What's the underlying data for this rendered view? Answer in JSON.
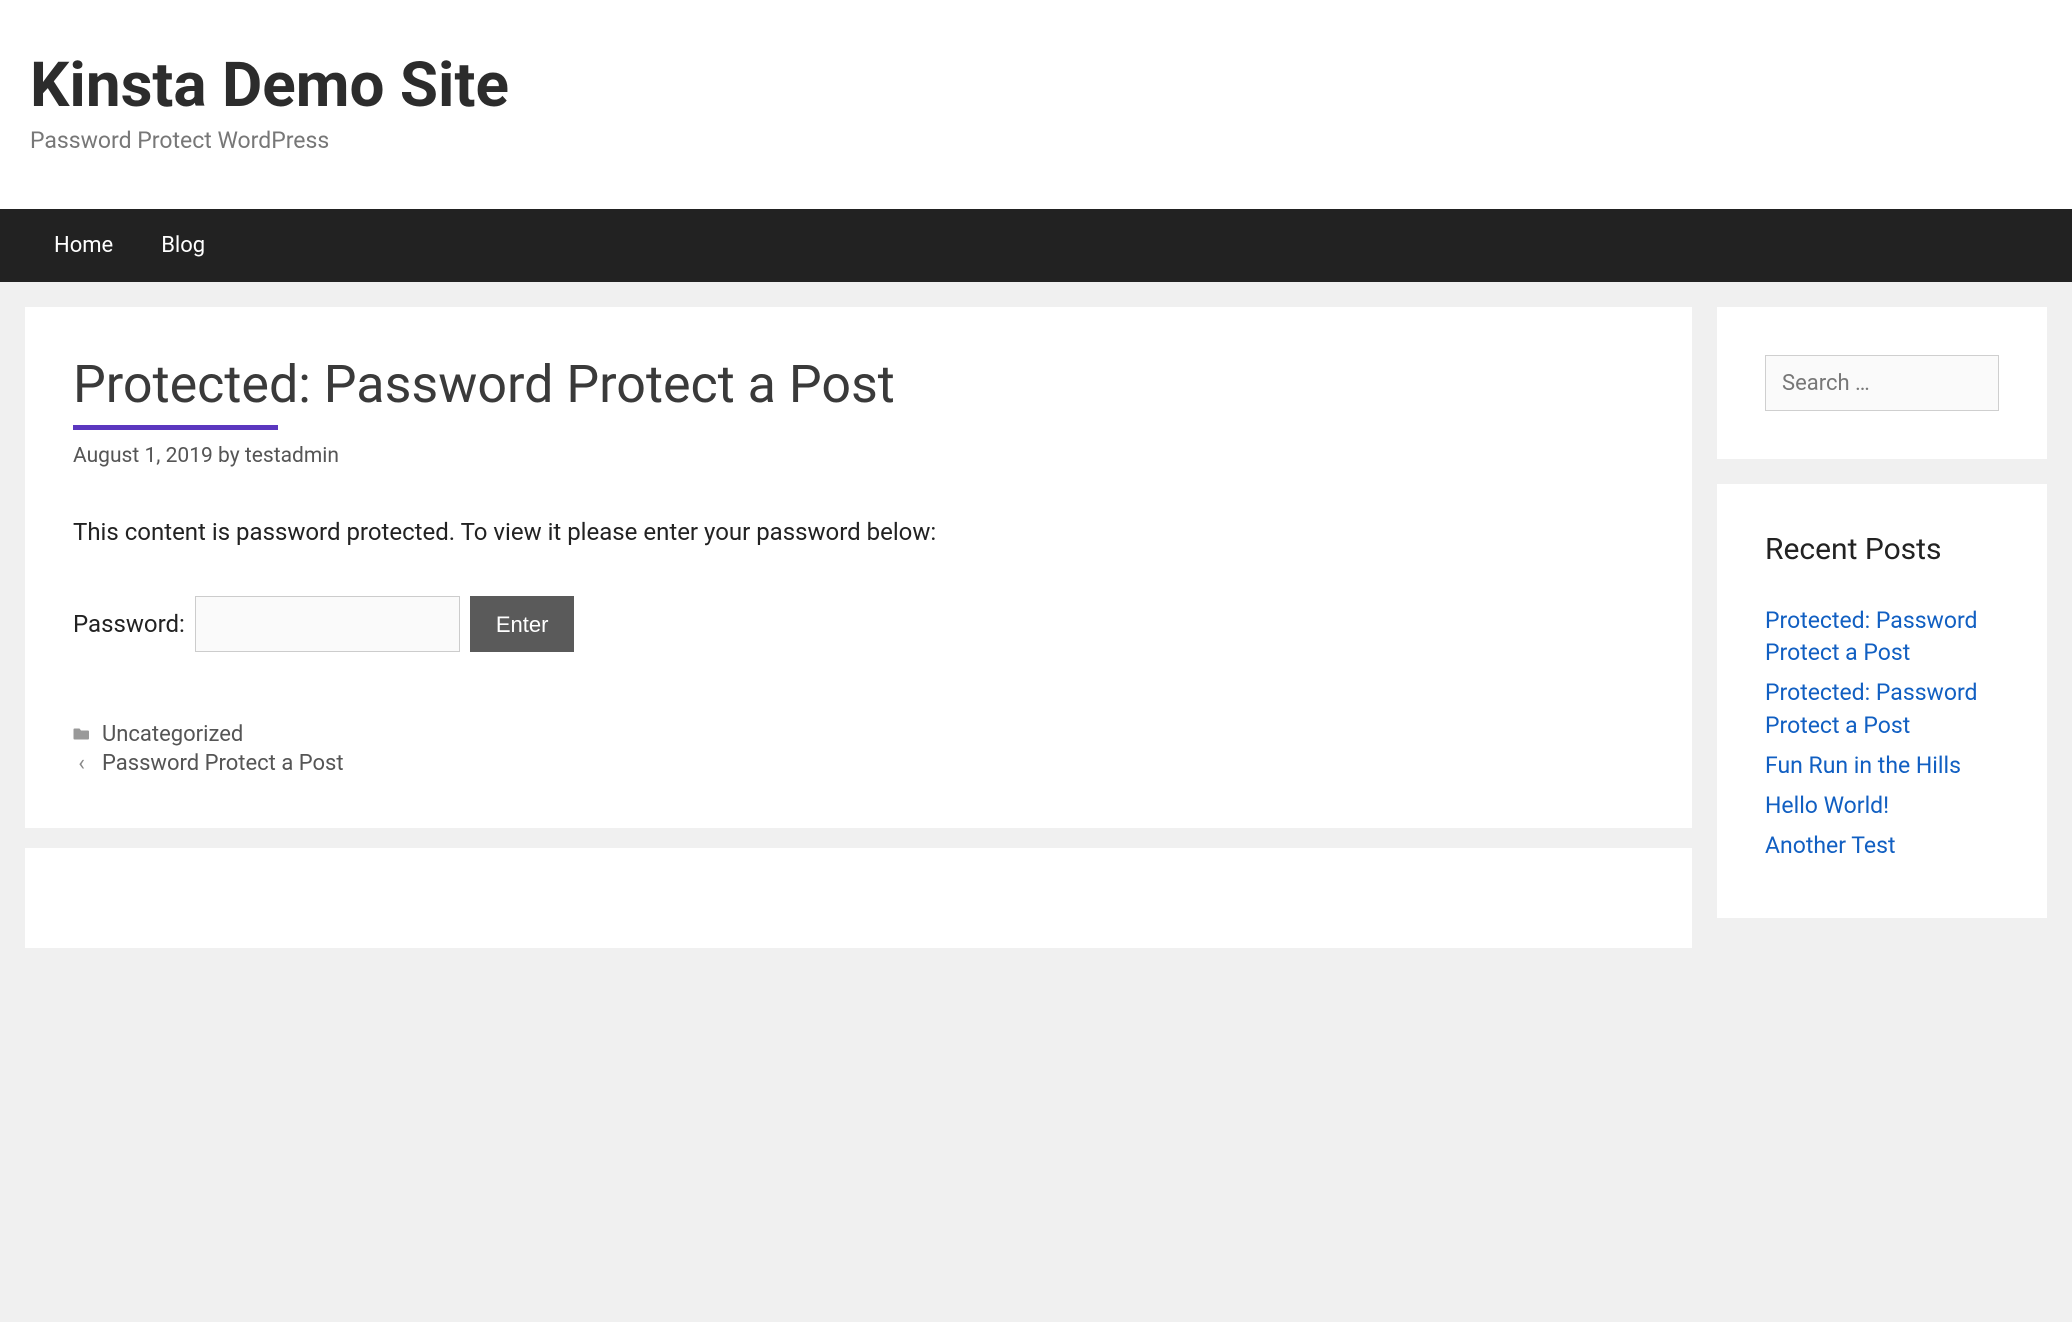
{
  "header": {
    "site_title": "Kinsta Demo Site",
    "tagline": "Password Protect WordPress"
  },
  "nav": {
    "items": [
      {
        "label": "Home"
      },
      {
        "label": "Blog"
      }
    ]
  },
  "article": {
    "title": "Protected: Password Protect a Post",
    "date": "August 1, 2019",
    "by_label": "by",
    "author": "testadmin",
    "protected_message": "This content is password protected. To view it please enter your password below:",
    "password_label": "Password:",
    "password_value": "",
    "submit_label": "Enter",
    "footer": {
      "category": "Uncategorized",
      "prev_link": "Password Protect a Post"
    }
  },
  "sidebar": {
    "search_placeholder": "Search …",
    "search_value": "",
    "recent_title": "Recent Posts",
    "recent_posts": [
      {
        "label": "Protected: Password Protect a Post"
      },
      {
        "label": "Protected: Password Protect a Post"
      },
      {
        "label": "Fun Run in the Hills"
      },
      {
        "label": "Hello World!"
      },
      {
        "label": "Another Test"
      }
    ]
  }
}
